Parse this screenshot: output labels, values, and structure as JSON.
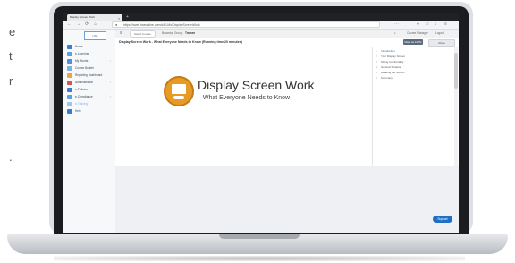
{
  "background_fragments": [
    {
      "text": "e"
    },
    {
      "text": "t"
    },
    {
      "text": "r"
    },
    {
      "text": "."
    }
  ],
  "browser": {
    "tab_title": "Display Screen Work",
    "tab_close": "×",
    "new_tab": "+",
    "back": "←",
    "forward": "→",
    "reload": "⟳",
    "home": "⌂",
    "url": "https://www.hseonline.com/s/ELMs/DisplayScreenWork",
    "menu_glyph": "⋯"
  },
  "sidebar": {
    "logo": "HSE",
    "items": [
      {
        "label": "Home",
        "color": "#3a7bd5",
        "chevron": ""
      },
      {
        "label": "e-Learning",
        "color": "#5aa0e6",
        "chevron": ""
      },
      {
        "label": "My Words",
        "color": "#4f8fdc",
        "chevron": "›"
      },
      {
        "label": "Course Builder",
        "color": "#7cb0e8",
        "chevron": ""
      },
      {
        "label": "Reporting Dashboard",
        "color": "#f2a33a",
        "chevron": ""
      },
      {
        "label": "Administration",
        "color": "#d9534f",
        "chevron": "›"
      },
      {
        "label": "e-Policies",
        "color": "#3a7bd5",
        "chevron": "›"
      },
      {
        "label": "e-Compliance",
        "color": "#5aa0e6",
        "chevron": "›"
      },
      {
        "label": "e-Training",
        "color": "#9ec5ee",
        "chevron": ""
      },
      {
        "label": "Help",
        "color": "#3a7bd5",
        "chevron": ""
      }
    ]
  },
  "subbar": {
    "menu_icon": "≡",
    "course_pill": "Select Course",
    "breadcrumb_prefix": "Browsing Group:",
    "breadcrumb_value": "Trainee",
    "user_label": "Course Manager",
    "logout": "Logout"
  },
  "page": {
    "title": "Display Screen Work - What Everyone Needs to Know (Running time 20 minutes)",
    "btn_primary": "Mark as 100%",
    "btn_secondary": "Close"
  },
  "video": {
    "title": "Display Screen Work",
    "subtitle": "– What Everyone Needs to Know"
  },
  "toc": [
    {
      "num": "1",
      "label": "Introduction",
      "active": true
    },
    {
      "num": "2",
      "label": "Your Display Screen",
      "active": false
    },
    {
      "num": "3",
      "label": "Sitting Comfortably",
      "active": false
    },
    {
      "num": "4",
      "label": "General Situation",
      "active": false
    },
    {
      "num": "5",
      "label": "Reading the Screen",
      "active": false
    },
    {
      "num": "6",
      "label": "Summary",
      "active": false
    }
  ],
  "support_button": "Support",
  "colors": {
    "accent": "#1f6fc6",
    "logo_orange": "#e79a24"
  }
}
